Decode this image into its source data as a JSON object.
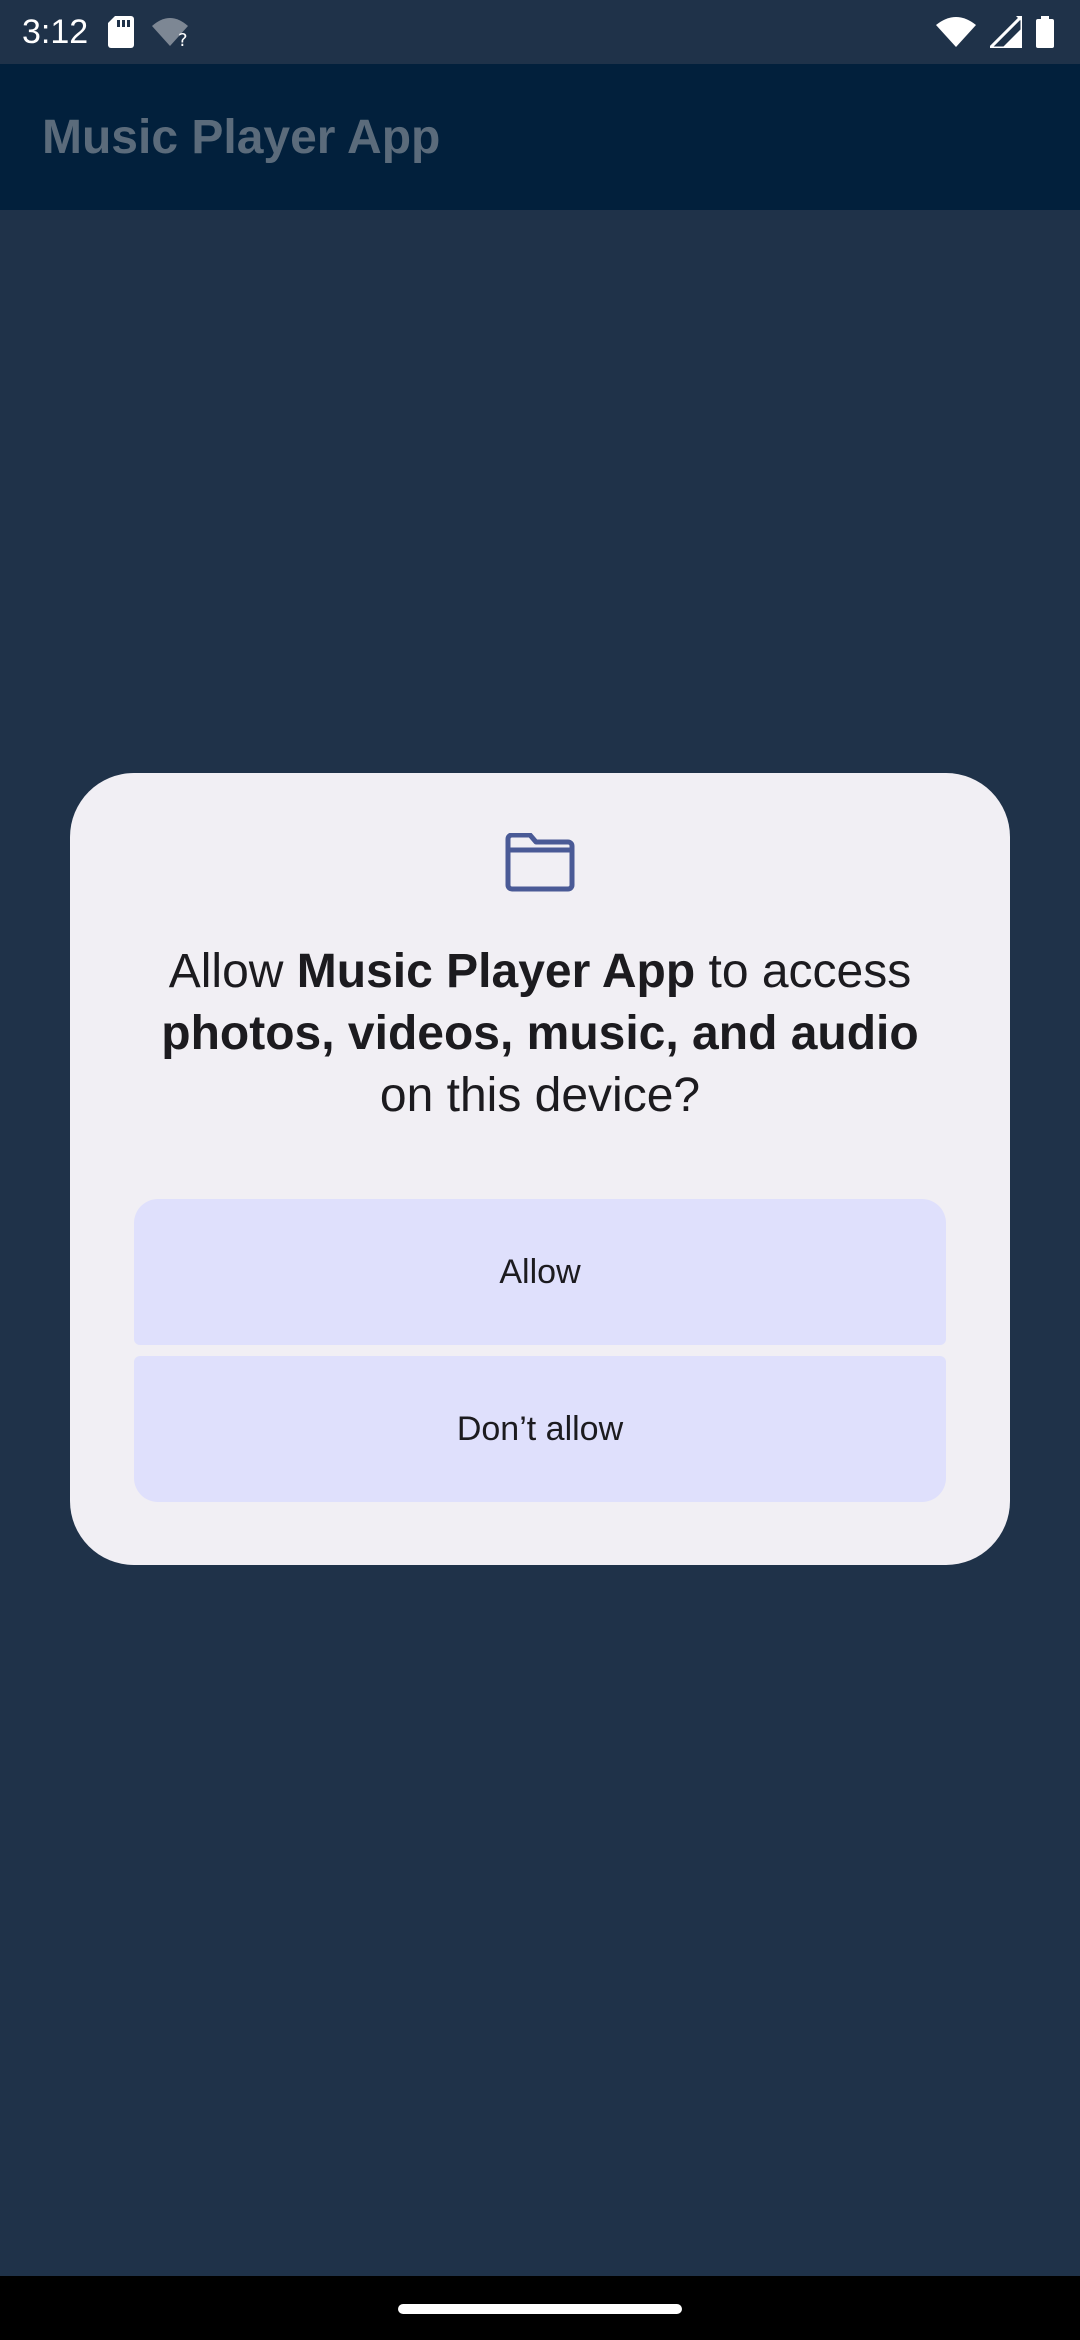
{
  "status_bar": {
    "time": "3:12",
    "left_icons": [
      "sd-card-icon",
      "wifi-question-icon"
    ],
    "right_icons": [
      "wifi-icon",
      "signal-icon",
      "battery-icon"
    ]
  },
  "app_bar": {
    "title": "Music Player App"
  },
  "dialog": {
    "icon": "folder-icon",
    "message_parts": {
      "prefix": "Allow ",
      "app_name": "Music Player App",
      "middle": " to access ",
      "resources": "photos, videos, music, and audio",
      "suffix": " on this device?"
    },
    "allow_label": "Allow",
    "deny_label": "Don’t allow"
  },
  "colors": {
    "background": "#1f3249",
    "app_bar": "#02203c",
    "dialog_surface": "#f1eff4",
    "button_fill": "#dfe0fc",
    "icon_accent": "#4a5a96"
  }
}
